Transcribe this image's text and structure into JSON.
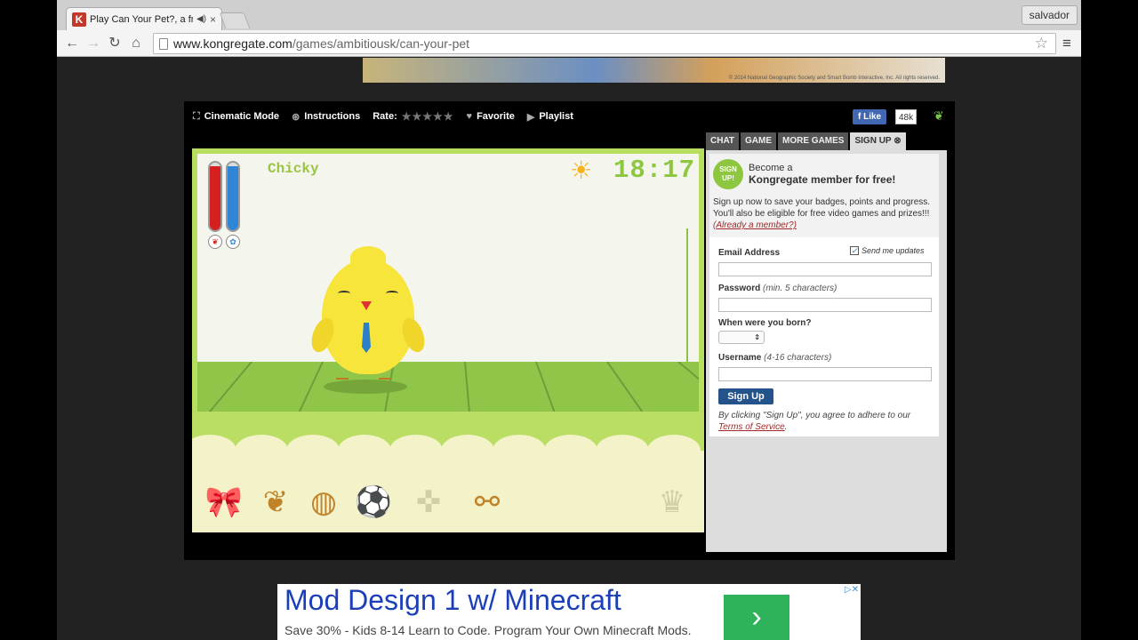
{
  "browser": {
    "tab_title": "Play Can Your Pet?, a fr",
    "tab_favicon": "K",
    "user": "salvador",
    "url_host": "www.kongregate.com",
    "url_path": "/games/ambitiousk/can-your-pet"
  },
  "game_bar": {
    "cinematic": "Cinematic Mode",
    "instructions": "Instructions",
    "rate": "Rate:",
    "stars": "★★★★★",
    "favorite": "Favorite",
    "playlist": "Playlist",
    "like": "Like",
    "like_count": "48k"
  },
  "game": {
    "pet_name": "Chicky",
    "clock": "18:17",
    "meters": [
      {
        "name": "food",
        "level": 0.95,
        "color": "#d62020"
      },
      {
        "name": "play",
        "level": 0.95,
        "color": "#2f86d6"
      }
    ],
    "tools": [
      "bow-icon",
      "food-bag-icon",
      "soap-icon",
      "toys-icon",
      "gamepad-icon",
      "bicycle-icon",
      "trophy-icon"
    ]
  },
  "side": {
    "tabs": [
      "CHAT",
      "GAME",
      "MORE GAMES",
      "SIGN UP"
    ],
    "badge": "SIGN UP!",
    "become_line1": "Become a",
    "become_line2": "Kongregate member for free!",
    "blurb": "Sign up now to save your badges, points and progress. You'll also be eligible for free video games and prizes!!!",
    "already_member": "(Already a member?)",
    "email_label": "Email Address",
    "send_updates": "Send me updates",
    "password_label": "Password",
    "password_hint": "(min. 5 characters)",
    "born_label": "When were you born?",
    "username_label": "Username",
    "username_hint": "(4-16 characters)",
    "signup_button": "Sign Up",
    "terms_prefix": "By clicking \"Sign Up\", you agree to adhere to our",
    "terms_link": "Terms of Service",
    "terms_suffix": "."
  },
  "ads": {
    "top_copyright": "© 2014 National Geographic Society and Smart Bomb Interactive, Inc. All rights reserved.",
    "bottom_title": "Mod Design 1 w/ Minecraft",
    "bottom_sub": "Save 30% - Kids 8-14 Learn to Code. Program Your Own Minecraft Mods."
  }
}
